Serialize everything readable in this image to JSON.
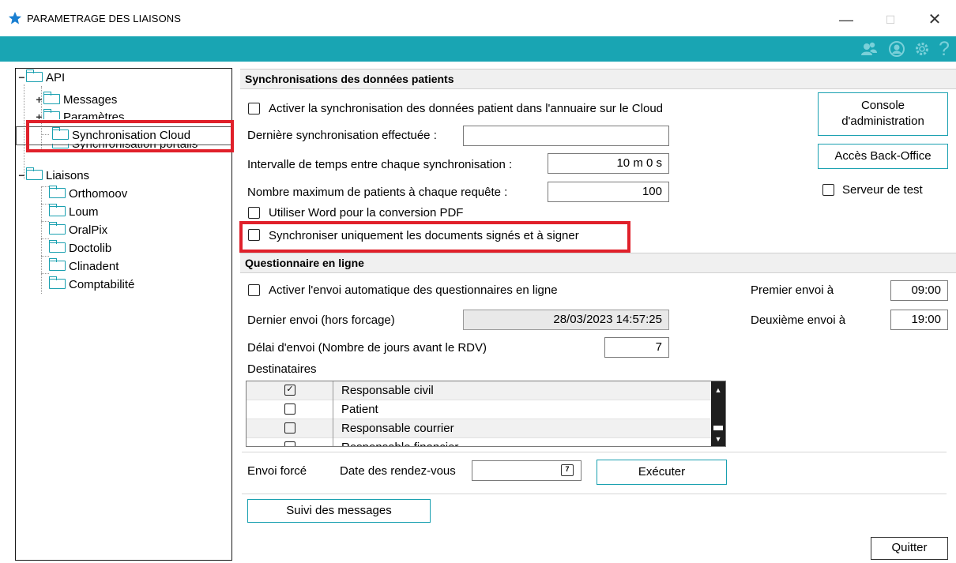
{
  "window": {
    "title": "PARAMETRAGE DES LIAISONS",
    "minimize": "—",
    "maximize": "☐",
    "close": "✕"
  },
  "colors": {
    "accent": "#19a5b3",
    "highlight": "#e0202a"
  },
  "toolbar": {
    "icons": [
      "users-icon",
      "user-icon",
      "gear-icon",
      "help-icon"
    ],
    "help_glyph": "?"
  },
  "tree": {
    "items": [
      {
        "label": "API",
        "expander": "−"
      },
      {
        "label": "Messages",
        "expander": "+"
      },
      {
        "label": "Paramètres",
        "expander": "+"
      },
      {
        "label": "Synchronisation Cloud"
      },
      {
        "label": "Synchronisation portails"
      },
      {
        "label": "Liaisons",
        "expander": "−"
      },
      {
        "label": "Orthomoov"
      },
      {
        "label": "Loum"
      },
      {
        "label": "OralPix"
      },
      {
        "label": "Doctolib"
      },
      {
        "label": "Clinadent"
      },
      {
        "label": "Comptabilité"
      }
    ]
  },
  "sync": {
    "header": "Synchronisations des données patients",
    "enable_label": "Activer la synchronisation des données patient dans l'annuaire sur le Cloud",
    "last_sync_label": "Dernière synchronisation effectuée :",
    "last_sync_value": "",
    "interval_label": "Intervalle de temps entre chaque synchronisation :",
    "interval_value": "10 m 0 s",
    "max_patients_label": "Nombre maximum de patients à chaque requête :",
    "max_patients_value": "100",
    "word_pdf_label": "Utiliser Word pour la conversion PDF",
    "signed_only_label": "Synchroniser uniquement les documents signés et à signer",
    "console_button_line1": "Console",
    "console_button_line2": "d'administration",
    "backoffice_button": "Accès Back-Office",
    "test_server_label": "Serveur de test"
  },
  "questionnaire": {
    "header": "Questionnaire en ligne",
    "enable_label": "Activer l'envoi automatique des questionnaires en ligne",
    "last_send_label": "Dernier envoi (hors forcage)",
    "last_send_value": "28/03/2023 14:57:25",
    "delay_label": "Délai d'envoi (Nombre de jours avant le RDV)",
    "delay_value": "7",
    "first_send_label": "Premier envoi à",
    "first_send_value": "09:00",
    "second_send_label": "Deuxième envoi à",
    "second_send_value": "19:00",
    "recipients_label": "Destinataires",
    "recipients": [
      {
        "label": "Responsable civil",
        "checked": true,
        "mark": "✓"
      },
      {
        "label": "Patient",
        "checked": false,
        "mark": ""
      },
      {
        "label": "Responsable courrier",
        "checked": false,
        "mark": ""
      },
      {
        "label": "Responsable financier",
        "checked": false,
        "mark": ""
      }
    ],
    "forced_label": "Envoi forcé",
    "appointments_date_label": "Date des rendez-vous",
    "appointments_date_value": "",
    "calendar_glyph": "7",
    "execute_button": "Exécuter",
    "messages_button": "Suivi des messages"
  },
  "footer": {
    "quit_button": "Quitter"
  }
}
